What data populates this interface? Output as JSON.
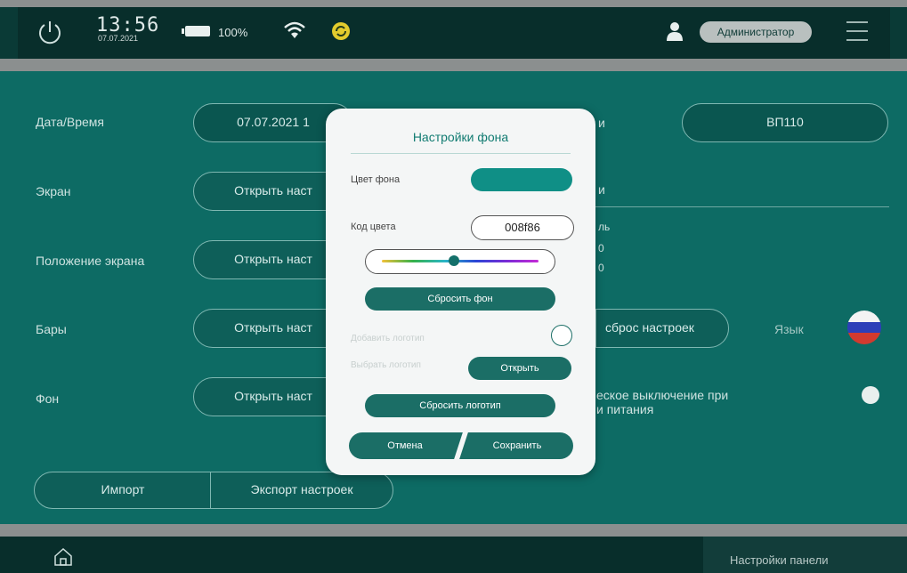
{
  "status_bar": {
    "time": "13:56",
    "date": "07.07.2021",
    "battery": "100%",
    "user_role": "Администратор"
  },
  "settings": {
    "rows": [
      {
        "label": "Дата/Время",
        "value": "07.07.2021 1"
      },
      {
        "label": "Экран",
        "value": "Открыть наст"
      },
      {
        "label": "Положение экрана",
        "value": "Открыть наст"
      },
      {
        "label": "Бары",
        "value": "Открыть наст"
      },
      {
        "label": "Фон",
        "value": "Открыть наст"
      }
    ],
    "right": {
      "model_value": "ВП110",
      "reset_label": "сброс настроек",
      "language_label": "Язык",
      "auto_off_line1": "еское выключение при",
      "auto_off_line2": "и питания",
      "fragments": [
        "и",
        "и",
        "ль",
        "0",
        "0"
      ]
    },
    "import_label": "Импорт",
    "export_label": "Экспорт настроек"
  },
  "modal": {
    "title": "Настройки фона",
    "bg_color_label": "Цвет фона",
    "color_code_label": "Код цвета",
    "color_code_value": "008f86",
    "reset_bg_label": "Сбросить фон",
    "add_logo_label": "Добавить логотип",
    "choose_logo_label": "Выбрать логотип",
    "open_label": "Открыть",
    "reset_logo_label": "Сбросить логотип",
    "cancel_label": "Отмена",
    "save_label": "Сохранить",
    "bg_color_hex": "#0f8f86",
    "slider_value": 0.46
  },
  "footer": {
    "title": "Настройки панели"
  },
  "colors": {
    "background": "#0d6b64",
    "topbar": "#082e2b",
    "accent": "#1b6e66"
  }
}
